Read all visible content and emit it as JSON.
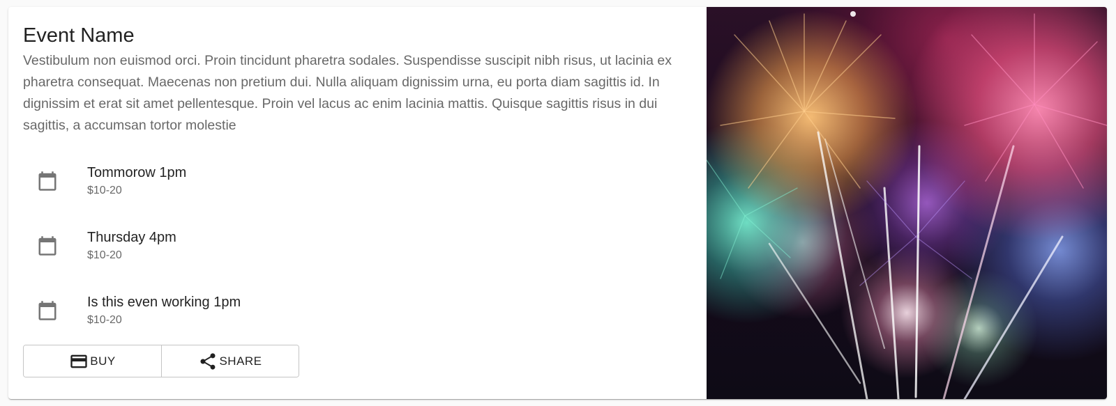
{
  "event": {
    "title": "Event Name",
    "description": "Vestibulum non euismod orci. Proin tincidunt pharetra sodales. Suspendisse suscipit nibh risus, ut lacinia ex pharetra consequat. Maecenas non pretium dui. Nulla aliquam dignissim urna, eu porta diam sagittis id. In dignissim et erat sit amet pellentesque. Proin vel lacus ac enim lacinia mattis. Quisque sagittis risus in dui sagittis, a accumsan tortor molestie"
  },
  "sessions": [
    {
      "time": "Tommorow 1pm",
      "price": "$10-20",
      "icon": "calendar-icon"
    },
    {
      "time": "Thursday 4pm",
      "price": "$10-20",
      "icon": "calendar-icon"
    },
    {
      "time": "Is this even working 1pm",
      "price": "$10-20",
      "icon": "calendar-icon"
    }
  ],
  "actions": {
    "buy_label": "BUY",
    "buy_icon": "credit-card-icon",
    "share_label": "SHARE",
    "share_icon": "share-icon"
  },
  "media": {
    "subject": "fireworks-image"
  }
}
